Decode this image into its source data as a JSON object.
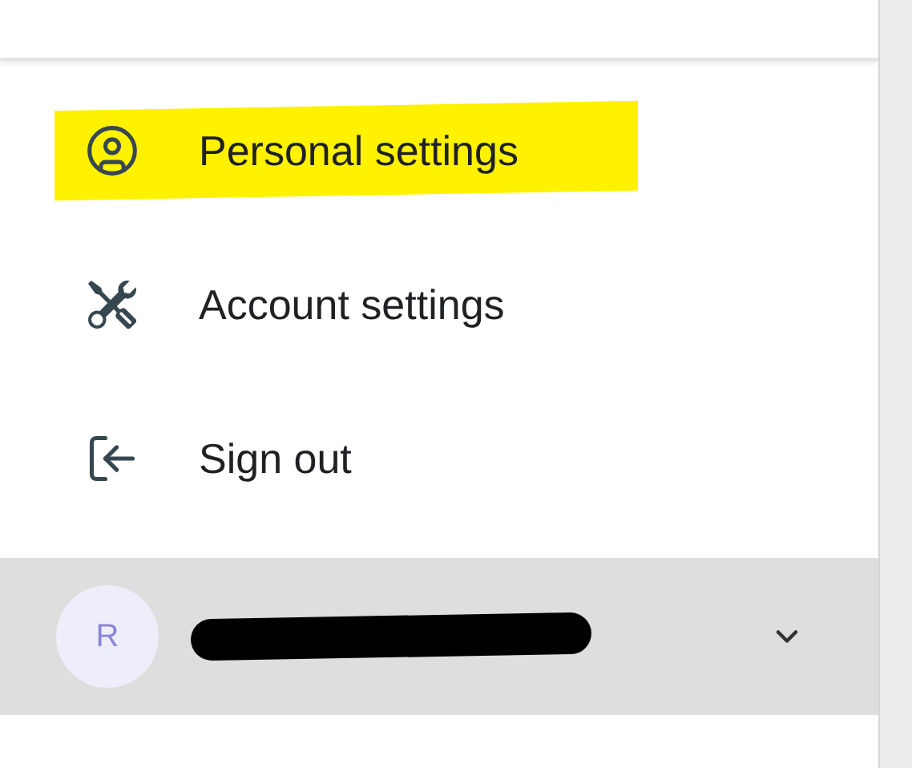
{
  "menu": {
    "items": [
      {
        "kind": "person",
        "label": "Personal settings",
        "highlighted": true
      },
      {
        "kind": "tools",
        "label": "Account settings",
        "highlighted": false
      },
      {
        "kind": "signout",
        "label": "Sign out",
        "highlighted": false
      }
    ]
  },
  "account": {
    "avatar": "R",
    "name_redacted": true
  }
}
